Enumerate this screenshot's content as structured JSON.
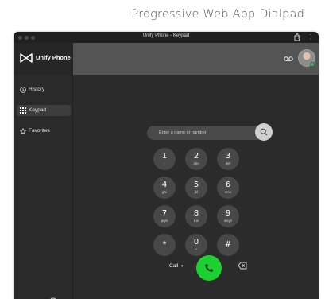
{
  "caption": "Progressive Web App Dialpad",
  "window": {
    "title": "Unify Phone - Keypad"
  },
  "brand": {
    "name": "Unify Phone"
  },
  "sidebar": {
    "items": [
      {
        "label": "History",
        "icon": "clock-icon",
        "active": false
      },
      {
        "label": "Keypad",
        "icon": "keypad-grid-icon",
        "active": true
      },
      {
        "label": "Favorites",
        "icon": "star-icon",
        "active": false
      }
    ]
  },
  "search": {
    "placeholder": "Enter a name or number"
  },
  "keypad": {
    "keys": [
      {
        "digit": "1",
        "letters": "-"
      },
      {
        "digit": "2",
        "letters": "abc"
      },
      {
        "digit": "3",
        "letters": "def"
      },
      {
        "digit": "4",
        "letters": "ghi"
      },
      {
        "digit": "5",
        "letters": "jkl"
      },
      {
        "digit": "6",
        "letters": "mno"
      },
      {
        "digit": "7",
        "letters": "pqrs"
      },
      {
        "digit": "8",
        "letters": "tuv"
      },
      {
        "digit": "9",
        "letters": "wxyz"
      },
      {
        "digit": "*",
        "letters": ""
      },
      {
        "digit": "0",
        "letters": "+"
      },
      {
        "digit": "#",
        "letters": ""
      }
    ]
  },
  "call": {
    "type_label": "Call"
  },
  "colors": {
    "call_green": "#1bd130",
    "presence_green": "#22c55e",
    "background": "#2b2b2b"
  }
}
